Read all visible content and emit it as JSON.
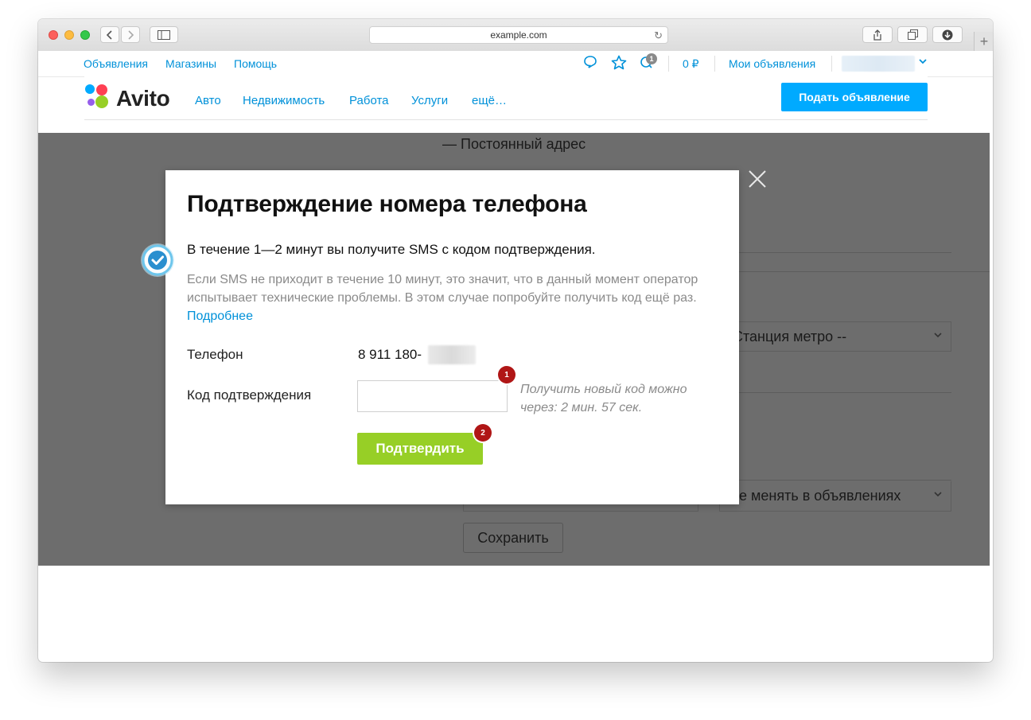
{
  "browser": {
    "url": "example.com"
  },
  "topnav": {
    "links": [
      "Объявления",
      "Магазины",
      "Помощь"
    ],
    "notification_count": "1",
    "balance": "0 ₽",
    "my_ads": "Мои объявления"
  },
  "header": {
    "logo_text": "Avito",
    "categories": [
      "Авто",
      "Недвижимость",
      "Работа",
      "Услуги",
      "ещё…"
    ],
    "post_button": "Подать объявление"
  },
  "background_form": {
    "address_label": "— Постоянный адрес",
    "metro_select": "Станция метро --",
    "visibility_select": "е менять в объявлениях",
    "save_button": "Сохранить"
  },
  "modal": {
    "title": "Подтверждение номера телефона",
    "lead": "В течение 1—2 минут вы получите SMS с кодом подтверждения.",
    "note": "Если SMS не приходит в течение 10 минут, это значит, что в данный момент оператор испытывает технические проблемы. В этом случае попробуйте получить код ещё раз.",
    "note_link": "Подробнее",
    "phone_label": "Телефон",
    "phone_value": "8 911 180-",
    "code_label": "Код подтверждения",
    "code_value": "",
    "resend_hint": "Получить новый код можно через: 2 мин. 57 сек.",
    "confirm_button": "Подтвердить"
  },
  "annotations": {
    "step1": "1",
    "step2": "2"
  },
  "colors": {
    "accent_blue": "#0091d9",
    "post_button": "#00aaff",
    "confirm_button": "#97cf26",
    "step_badge": "#b01616",
    "overlay": "#6d6d6d"
  }
}
